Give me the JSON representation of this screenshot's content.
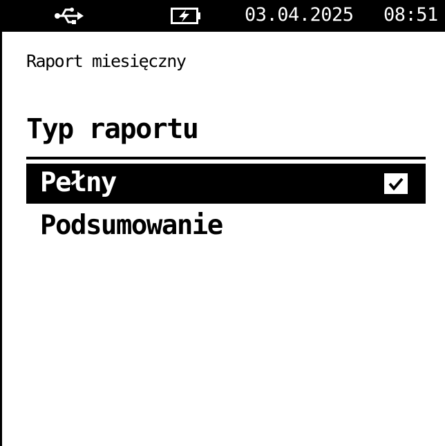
{
  "status_bar": {
    "usb_icon": "usb-icon",
    "battery_icon": "battery-charging-icon",
    "date": "03.04.2025",
    "time": "08:51"
  },
  "screen": {
    "title": "Raport miesięczny",
    "section_heading": "Typ raportu"
  },
  "report_types": [
    {
      "label": "Pełny",
      "selected": true,
      "check_icon": "checkmark-icon"
    },
    {
      "label": "Podsumowanie",
      "selected": false
    }
  ],
  "colors": {
    "foreground": "#000000",
    "background": "#ffffff",
    "selection_background": "#000000",
    "selection_text": "#ffffff"
  }
}
